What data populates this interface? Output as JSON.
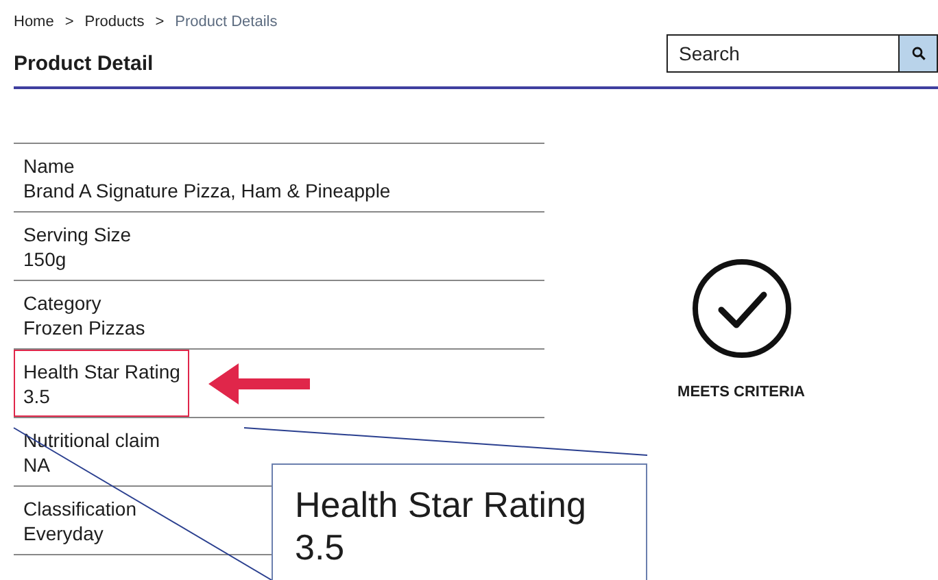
{
  "breadcrumb": [
    {
      "label": "Home",
      "current": false
    },
    {
      "label": "Products",
      "current": false
    },
    {
      "label": "Product Details",
      "current": true
    }
  ],
  "breadcrumb_separator": ">",
  "title": "Product Detail",
  "search": {
    "placeholder": "Search"
  },
  "fields": [
    {
      "label": "Name",
      "value": "Brand A Signature Pizza, Ham & Pineapple",
      "highlighted": false
    },
    {
      "label": "Serving Size",
      "value": "150g",
      "highlighted": false
    },
    {
      "label": "Category",
      "value": "Frozen Pizzas",
      "highlighted": false
    },
    {
      "label": "Health Star Rating",
      "value": "3.5",
      "highlighted": true
    },
    {
      "label": "Nutritional claim",
      "value": "NA",
      "highlighted": false
    },
    {
      "label": "Classification",
      "value": "Everyday",
      "highlighted": false
    }
  ],
  "result": {
    "status": "MEETS CRITERIA",
    "passed": true
  },
  "magnifier": {
    "label": "Health Star Rating",
    "value": "3.5"
  }
}
